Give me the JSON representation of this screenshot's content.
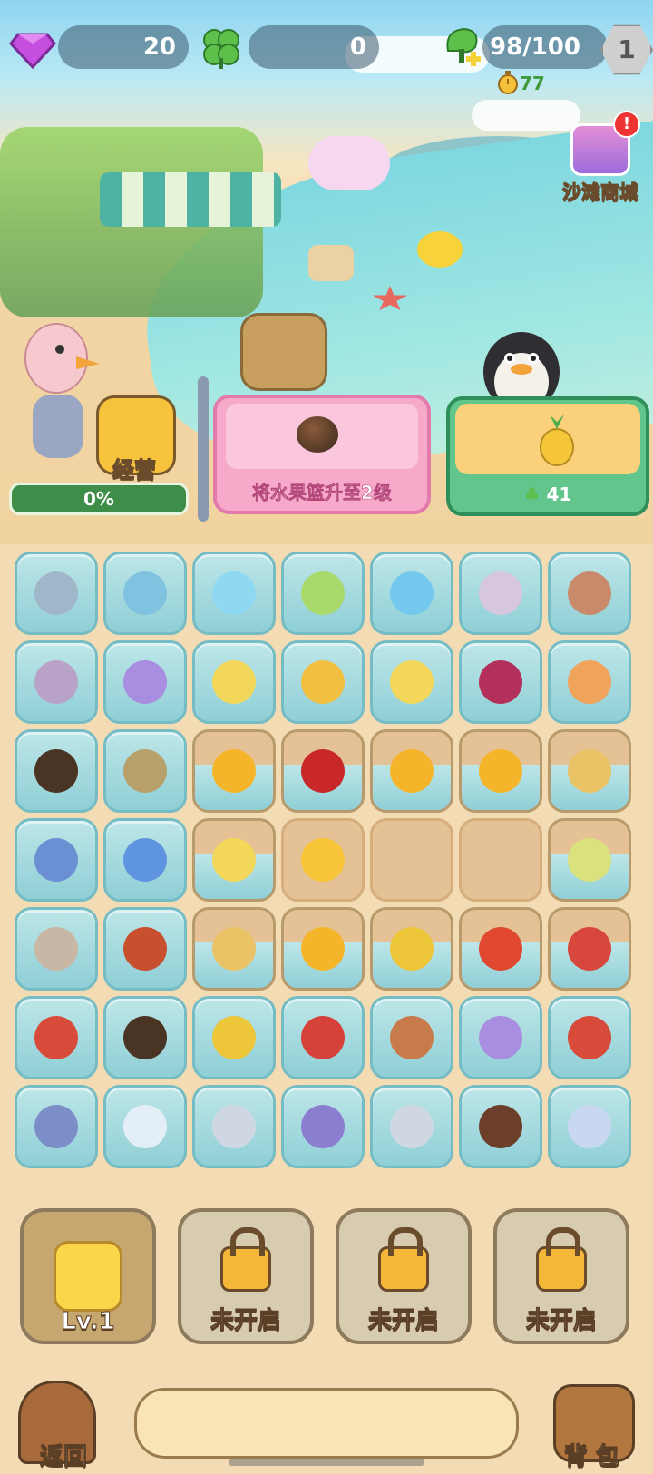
{
  "hud": {
    "gems": "20",
    "clovers": "0",
    "energy": "98/100",
    "level": "1",
    "timer": "77"
  },
  "shop": {
    "label": "沙滩商城",
    "alert": "!"
  },
  "operations": {
    "label": "经营",
    "progress": "0%"
  },
  "quest": {
    "text": "将水果篮升至2级"
  },
  "reward": {
    "amount": "41"
  },
  "board": {
    "rows": [
      [
        "glass:hook",
        "glass:towel",
        "glass:ice",
        "glass:bag",
        "glass:icecubes",
        "glass:jar",
        "glass:cup"
      ],
      [
        "glass:backpack",
        "glass:starfish",
        "glass:banana",
        "glass:mango",
        "glass:banana",
        "glass:raspberry",
        "glass:pufferfish"
      ],
      [
        "glass:coconut",
        "glass:eel",
        "water:orange",
        "water:cherry",
        "water:orange",
        "water:orange",
        "water:melon"
      ],
      [
        "glass:coral",
        "glass:seahorse",
        "water:banana",
        "empty:lemon",
        "empty:",
        "empty:",
        "water:pear"
      ],
      [
        "glass:sandwich",
        "glass:lobster",
        "water:melon",
        "water:orange",
        "water:corn",
        "water:watermelon",
        "water:fish"
      ],
      [
        "glass:strawberry",
        "glass:coconut",
        "glass:corn",
        "glass:tomato",
        "glass:crab",
        "glass:starfish",
        "glass:strawberry"
      ],
      [
        "glass:wallet",
        "glass:bottle",
        "glass:box",
        "glass:mirror",
        "glass:box",
        "glass:popsicle",
        "glass:sunscreen"
      ]
    ],
    "item_colors": {
      "hook": "#9fb7c9",
      "towel": "#7fc3e0",
      "ice": "#8fd8f2",
      "bag": "#a9d86b",
      "icecubes": "#74c8ee",
      "jar": "#d6c7df",
      "cup": "#c88a6b",
      "backpack": "#b9a2c7",
      "starfish": "#a88de0",
      "banana": "#f3d75a",
      "mango": "#f2c040",
      "raspberry": "#b3305a",
      "pufferfish": "#f0a35a",
      "coconut": "#4a3524",
      "eel": "#b8a06a",
      "orange": "#f5b52a",
      "cherry": "#c8282a",
      "melon": "#e9c366",
      "coral": "#6b8fd3",
      "seahorse": "#5e94e0",
      "lemon": "#f7c537",
      "pear": "#d9e27d",
      "sandwich": "#c7b7a4",
      "lobster": "#c8502f",
      "corn": "#eec63a",
      "watermelon": "#e0492f",
      "fish": "#d7473c",
      "strawberry": "#d84a3a",
      "tomato": "#d6423a",
      "crab": "#c87a4a",
      "wallet": "#7c8ec7",
      "bottle": "#e4eef6",
      "box": "#cfd8e2",
      "mirror": "#8b7dcf",
      "popsicle": "#6b3f2a",
      "sunscreen": "#c8d8f0"
    }
  },
  "slots": [
    {
      "label": "Lv.1",
      "active": true
    },
    {
      "label": "未开启",
      "active": false
    },
    {
      "label": "未开启",
      "active": false
    },
    {
      "label": "未开启",
      "active": false
    }
  ],
  "nav": {
    "back_label": "返回",
    "bag_label": "背 包"
  }
}
